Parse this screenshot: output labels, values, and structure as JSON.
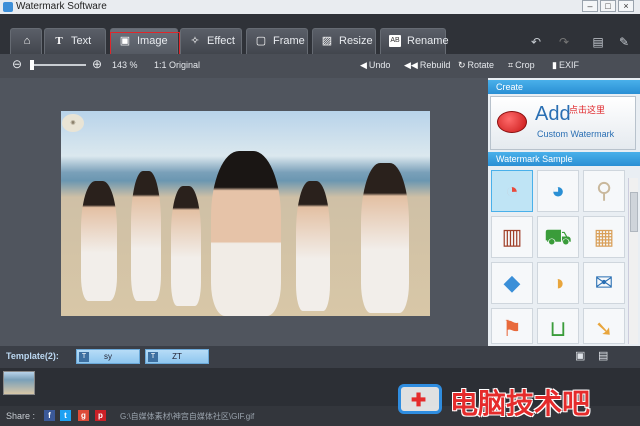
{
  "window": {
    "title": "Watermark Software"
  },
  "tabs": [
    {
      "label": "",
      "icon": "home-icon"
    },
    {
      "label": "Text",
      "icon": "text-icon"
    },
    {
      "label": "Image",
      "icon": "image-icon"
    },
    {
      "label": "Effect",
      "icon": "wand-icon"
    },
    {
      "label": "Frame",
      "icon": "frame-icon"
    },
    {
      "label": "Resize",
      "icon": "resize-icon"
    },
    {
      "label": "Rename",
      "icon": "rename-icon"
    }
  ],
  "toolbar": {
    "zoom_value": "143 %",
    "original_prefix": "1:1",
    "original_label": "Original",
    "undo": "Undo",
    "rebuild": "Rebuild",
    "rotate": "Rotate",
    "crop": "Crop",
    "exif": "EXIF"
  },
  "panel": {
    "create_title": "Create",
    "add_label": "Add",
    "custom_label": "Custom Watermark",
    "annotation": "点击这里",
    "sample_title": "Watermark Sample",
    "samples": [
      "pie-chart-icon",
      "pie-chart-icon",
      "tags-icon",
      "server-icon",
      "cart-add-icon",
      "box-icon",
      "tag-icon",
      "pie-chart-icon",
      "email-icon",
      "door-tag-icon",
      "basket-icon",
      "arrow-icon"
    ]
  },
  "template": {
    "label": "Template(2):",
    "items": [
      "sy",
      "ZT"
    ]
  },
  "bottom": {
    "share": "Share :",
    "path": "G:\\自媒体素材\\神宫自媒体社区\\GIF.gif"
  },
  "watermark": {
    "text": "电脑技术吧"
  },
  "colors": {
    "accent": "#2a8fd4",
    "highlight": "#e0262a",
    "panel_bg": "#e9eef3"
  }
}
